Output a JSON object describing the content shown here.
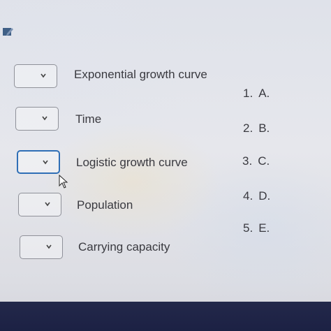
{
  "matching": {
    "rows": [
      {
        "term": "Exponential growth curve",
        "selected": ""
      },
      {
        "term": "Time",
        "selected": ""
      },
      {
        "term": "Logistic growth curve",
        "selected": ""
      },
      {
        "term": "Population",
        "selected": ""
      },
      {
        "term": "Carrying capacity",
        "selected": ""
      }
    ],
    "options": [
      {
        "number": "1.",
        "letter": "A."
      },
      {
        "number": "2.",
        "letter": "B."
      },
      {
        "number": "3.",
        "letter": "C."
      },
      {
        "number": "4.",
        "letter": "D."
      },
      {
        "number": "5.",
        "letter": "E."
      }
    ]
  },
  "colors": {
    "focus_border": "#2f6fb6",
    "bottom_bar": "#1f2446"
  },
  "icons": {
    "page_icon": "pencil-document-icon",
    "chevron": "chevron-down-icon",
    "cursor": "mouse-pointer-icon"
  }
}
